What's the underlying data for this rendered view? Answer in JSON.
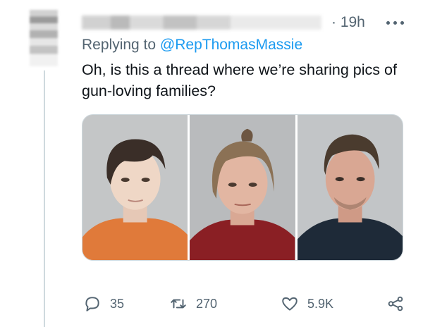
{
  "tweet": {
    "time": "· 19h",
    "replying_prefix": "Replying to ",
    "replying_handle": "@RepThomasMassie",
    "text": "Oh, is this a thread where we’re sharing pics of gun-loving families?"
  },
  "media": {
    "photos": [
      {
        "name": "mugshot-teen",
        "bg": "#c4c6c7",
        "shirt": "#e07a3a",
        "hair": "#3a2e28",
        "skin": "#efd7c6"
      },
      {
        "name": "mugshot-woman",
        "bg": "#b9bbbd",
        "shirt": "#8a1f24",
        "hair": "#8b7155",
        "skin": "#e2b6a2"
      },
      {
        "name": "mugshot-man",
        "bg": "#c2c5c7",
        "shirt": "#1e2a38",
        "hair": "#4a3b2e",
        "skin": "#d9a793"
      }
    ]
  },
  "actions": {
    "reply_count": "35",
    "retweet_count": "270",
    "like_count": "5.9K"
  },
  "colors": {
    "accent": "#1d9bf0",
    "muted": "#536471"
  }
}
